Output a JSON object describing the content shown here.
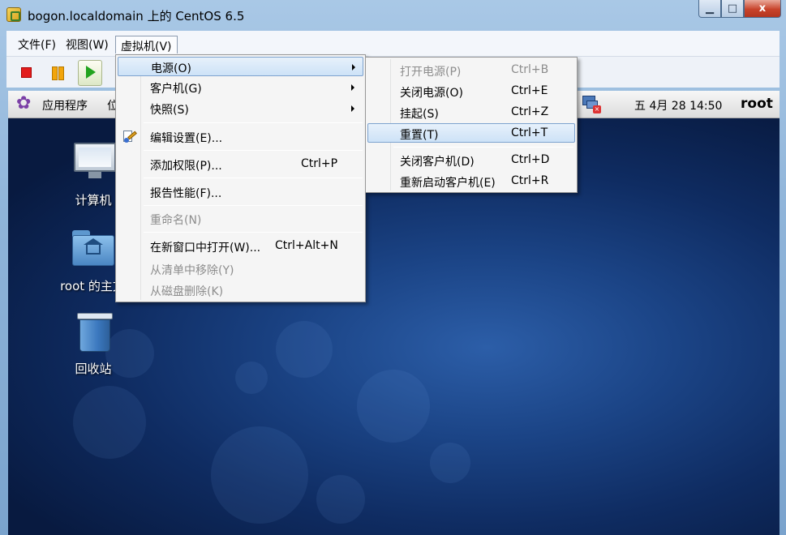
{
  "window": {
    "title": "bogon.localdomain 上的 CentOS 6.5",
    "buttons": {
      "minimize": "▁",
      "maximize": "□",
      "close": "x"
    }
  },
  "menubar": {
    "items": [
      "文件(F)",
      "视图(W)",
      "虚拟机(V)"
    ],
    "active": "虚拟机(V)"
  },
  "toolbar": {
    "buttons": [
      "stop",
      "pause",
      "play"
    ]
  },
  "guest_panel": {
    "apps": "应用程序",
    "places": "位",
    "clock": "五 4月 28 14:50",
    "user": "root"
  },
  "desktop_icons": [
    {
      "label": "计算机",
      "icon": "computer-icon"
    },
    {
      "label": "root 的主文",
      "icon": "home-folder-icon"
    },
    {
      "label": "回收站",
      "icon": "trash-icon"
    }
  ],
  "vm_menu": {
    "items": [
      {
        "label": "电源(O)",
        "shortcut": "",
        "submenu": true,
        "highlighted": true
      },
      {
        "label": "客户机(G)",
        "shortcut": "",
        "submenu": true
      },
      {
        "label": "快照(S)",
        "shortcut": "",
        "submenu": true
      },
      {
        "label": "编辑设置(E)...",
        "shortcut": "",
        "icon": "edit-settings-icon"
      },
      {
        "label": "添加权限(P)...",
        "shortcut": "Ctrl+P"
      },
      {
        "label": "报告性能(F)...",
        "shortcut": ""
      },
      {
        "label": "重命名(N)",
        "shortcut": "",
        "disabled": true
      },
      {
        "label": "在新窗口中打开(W)...",
        "shortcut": "Ctrl+Alt+N"
      },
      {
        "label": "从清单中移除(Y)",
        "shortcut": "",
        "disabled": true
      },
      {
        "label": "从磁盘删除(K)",
        "shortcut": "",
        "disabled": true
      }
    ]
  },
  "power_menu": {
    "items": [
      {
        "label": "打开电源(P)",
        "shortcut": "Ctrl+B",
        "disabled": true
      },
      {
        "label": "关闭电源(O)",
        "shortcut": "Ctrl+E"
      },
      {
        "label": "挂起(S)",
        "shortcut": "Ctrl+Z"
      },
      {
        "label": "重置(T)",
        "shortcut": "Ctrl+T",
        "highlighted": true
      },
      {
        "label": "关闭客户机(D)",
        "shortcut": "Ctrl+D"
      },
      {
        "label": "重新启动客户机(E)",
        "shortcut": "Ctrl+R"
      }
    ]
  }
}
